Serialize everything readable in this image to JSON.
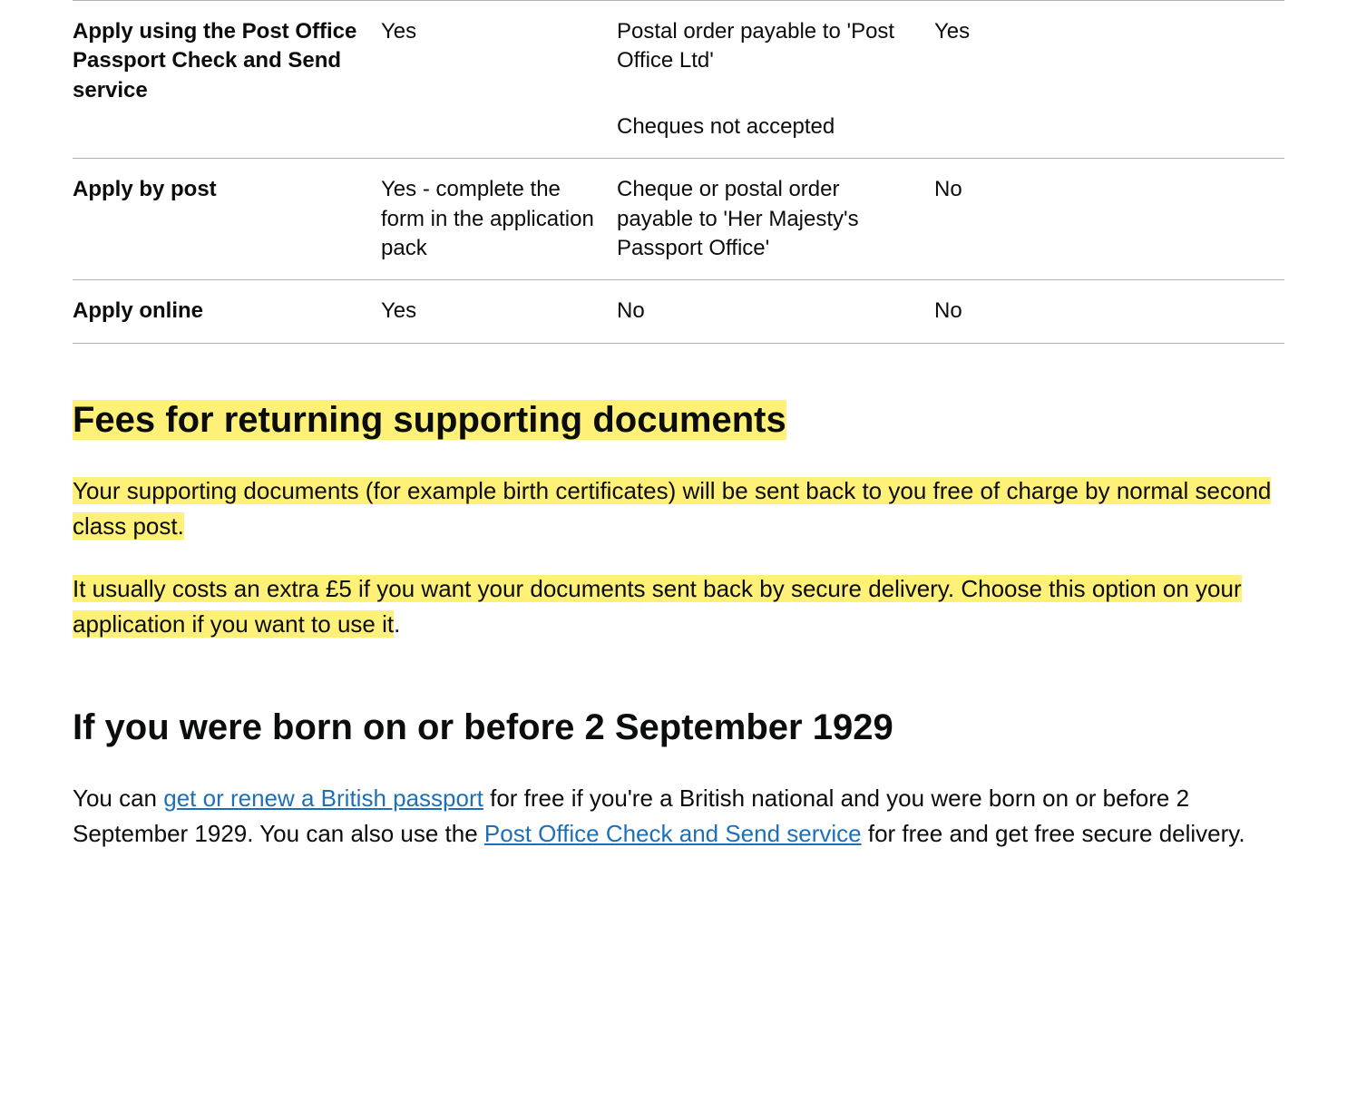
{
  "table": {
    "rows": [
      {
        "method": "Apply using the Post Office Passport Check and Send service",
        "debitCredit": "Yes",
        "chequePostal": "Postal order payable to 'Post Office Ltd'",
        "chequePostalSecondary": "Cheques not accepted",
        "cash": "Yes"
      },
      {
        "method": "Apply by post",
        "debitCredit": "Yes - complete the form in the application pack",
        "chequePostal": "Cheque or postal order payable to 'Her Majesty's Passport Office'",
        "cash": "No"
      },
      {
        "method": "Apply online",
        "debitCredit": "Yes",
        "chequePostal": "No",
        "cash": "No"
      }
    ]
  },
  "feesSection": {
    "heading": "Fees for returning supporting documents",
    "para1": "Your supporting documents (for example birth certificates) will be sent back to you free of charge by normal second class post.",
    "para2Highlighted": "It usually costs an extra £5 if you want your documents sent back by secure delivery. Choose this option on your application if you want to use it",
    "para2End": "."
  },
  "bornBeforeSection": {
    "heading": "If you were born on or before 2 September 1929",
    "para1Start": "You can ",
    "link1": "get or renew a British passport",
    "para1Middle": " for free if you're a British national and you were born on or before 2 September 1929. You can also use the ",
    "link2": "Post Office Check and Send service",
    "para1End": " for free and get free secure delivery."
  }
}
